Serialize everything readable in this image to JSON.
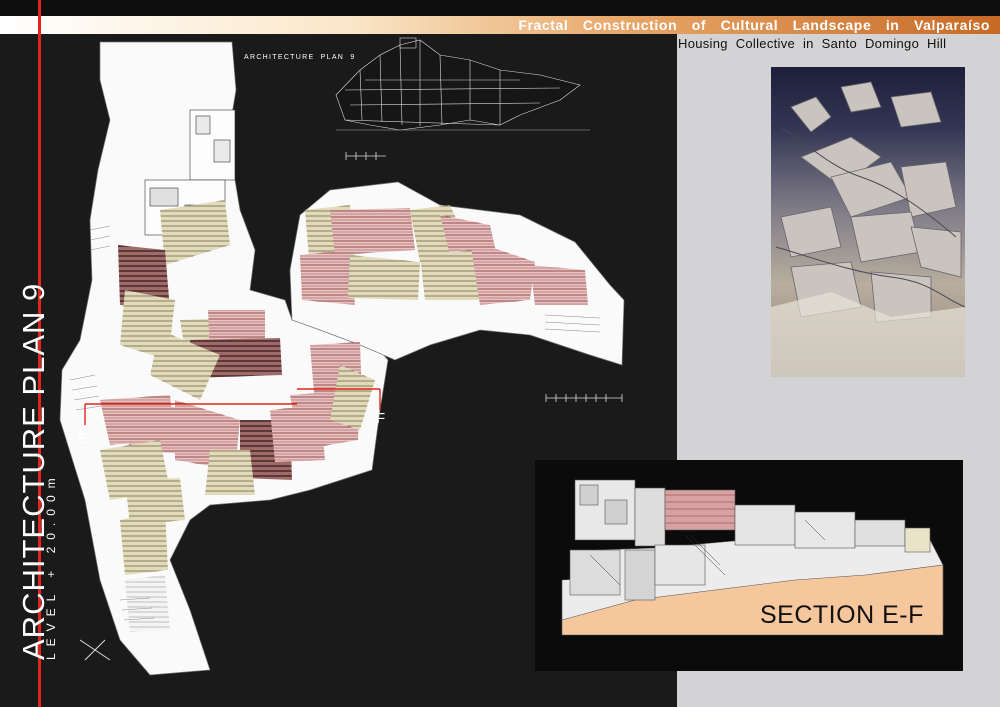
{
  "header": {
    "title": "Fractal Construction of Cultural Landscape in Valparaíso",
    "subtitle": "Housing Collective in Santo Domingo Hill"
  },
  "sidebar": {
    "main_title": "ARCHITECTURE PLAN 9",
    "level_label": "LEVEL + 20.00m"
  },
  "plan": {
    "elevation_label": "ARCHITECTURE PLAN 9",
    "cut_start": "E",
    "cut_end": "F"
  },
  "section": {
    "label": "SECTION E-F"
  },
  "colors": {
    "accent_red": "#e0261b",
    "title_gradient_end": "#c76a26",
    "roof_pink": "#d9a2a2",
    "roof_olive": "#c9bd8f",
    "section_ground": "#f6c79c"
  }
}
